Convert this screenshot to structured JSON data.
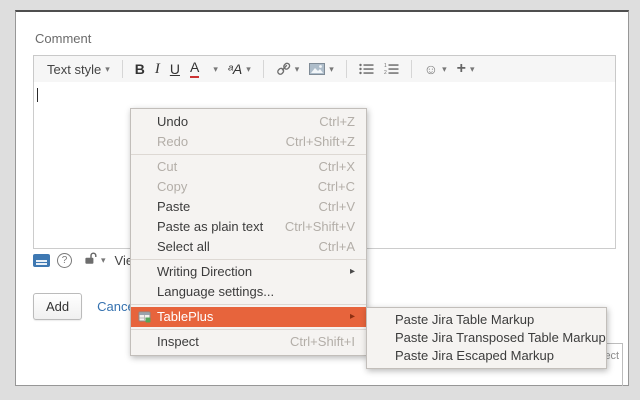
{
  "colors": {
    "accent_orange": "#e7643c",
    "link_blue": "#3572b0",
    "text_color_red": "#cc3333",
    "wiki_icon_blue": "#3e78b2"
  },
  "icons": {
    "caret_down": "▾",
    "submenu_arrow": "▸",
    "plus": "+",
    "smiley": "☺",
    "help": "?"
  },
  "comment_form": {
    "label": "Comment",
    "toolbar": {
      "text_style": "Text style",
      "bold": "B",
      "italic": "I",
      "underline": "U",
      "text_color": "A",
      "more_formatting": "ᵃA"
    },
    "editor_value": "",
    "visibility_text": "Viewa",
    "add_button": "Add",
    "cancel_link": "Cancel"
  },
  "context_menu": {
    "undo": {
      "label": "Undo",
      "shortcut": "Ctrl+Z"
    },
    "redo": {
      "label": "Redo",
      "shortcut": "Ctrl+Shift+Z"
    },
    "cut": {
      "label": "Cut",
      "shortcut": "Ctrl+X"
    },
    "copy": {
      "label": "Copy",
      "shortcut": "Ctrl+C"
    },
    "paste": {
      "label": "Paste",
      "shortcut": "Ctrl+V"
    },
    "paste_plain": {
      "label": "Paste as plain text",
      "shortcut": "Ctrl+Shift+V"
    },
    "select_all": {
      "label": "Select all",
      "shortcut": "Ctrl+A"
    },
    "writing_direction": {
      "label": "Writing Direction"
    },
    "language_settings": {
      "label": "Language settings..."
    },
    "tableplus": {
      "label": "TablePlus"
    },
    "inspect": {
      "label": "Inspect",
      "shortcut": "Ctrl+Shift+I"
    }
  },
  "tableplus_submenu": {
    "item1": "Paste Jira Table Markup",
    "item2": "Paste Jira Transposed Table Markup",
    "item3": "Paste Jira Escaped Markup"
  },
  "background": {
    "partial_text": "ject"
  }
}
